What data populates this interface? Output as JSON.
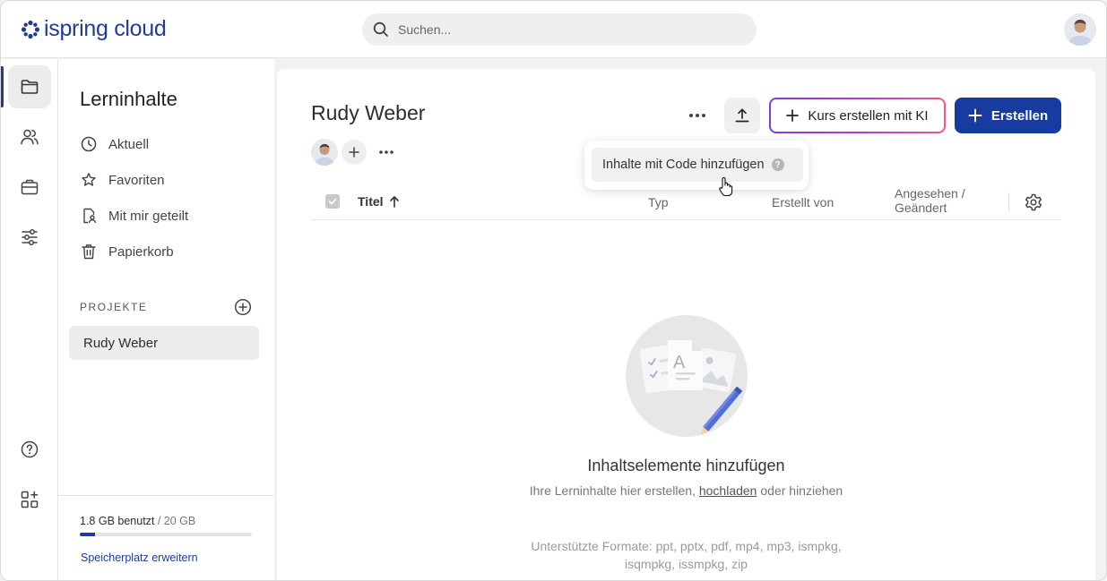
{
  "header": {
    "logo_text": "ispring cloud",
    "search_placeholder": "Suchen..."
  },
  "rail": {
    "items": [
      {
        "icon": "folder-icon",
        "active": true
      },
      {
        "icon": "users-icon",
        "active": false
      },
      {
        "icon": "briefcase-icon",
        "active": false
      },
      {
        "icon": "sliders-icon",
        "active": false
      },
      {
        "icon": "help-circle-icon",
        "active": false
      },
      {
        "icon": "apps-add-icon",
        "active": false
      }
    ]
  },
  "sidebar": {
    "title": "Lerninhalte",
    "items": [
      {
        "label": "Aktuell",
        "icon": "clock-icon"
      },
      {
        "label": "Favoriten",
        "icon": "star-icon"
      },
      {
        "label": "Mit mir geteilt",
        "icon": "shared-doc-icon"
      },
      {
        "label": "Papierkorb",
        "icon": "trash-icon"
      }
    ],
    "projects_label": "PROJEKTE",
    "projects": [
      {
        "label": "Rudy Weber",
        "selected": true
      }
    ],
    "storage": {
      "used": "1.8 GB benutzt",
      "total": " / 20 GB",
      "used_fraction": 0.09,
      "expand_link": "Speicherplatz erweitern"
    }
  },
  "main": {
    "title": "Rudy Weber",
    "ai_button_label": "Kurs erstellen mit KI",
    "create_button_label": "Erstellen",
    "popup_item_label": "Inhalte mit Code hinzufügen",
    "popup_help": "?",
    "table": {
      "col_title": "Titel",
      "col_type": "Typ",
      "col_creator": "Erstellt von",
      "col_viewed_line1": "Angesehen /",
      "col_viewed_line2": "Geändert"
    },
    "empty": {
      "title": "Inhaltselemente hinzufügen",
      "sub_before": "Ihre Lerninhalte hier erstellen, ",
      "sub_link": "hochladen",
      "sub_after": " oder hinziehen",
      "formats": "Unterstützte Formate: ppt, pptx, pdf, mp4, mp3, ismpkg, isqmpkg, issmpkg, zip"
    }
  },
  "colors": {
    "brand": "#1f3c9a",
    "primary_button": "#173b9e",
    "ai_gradient_start": "#7a3de6",
    "ai_gradient_end": "#f0578c"
  }
}
